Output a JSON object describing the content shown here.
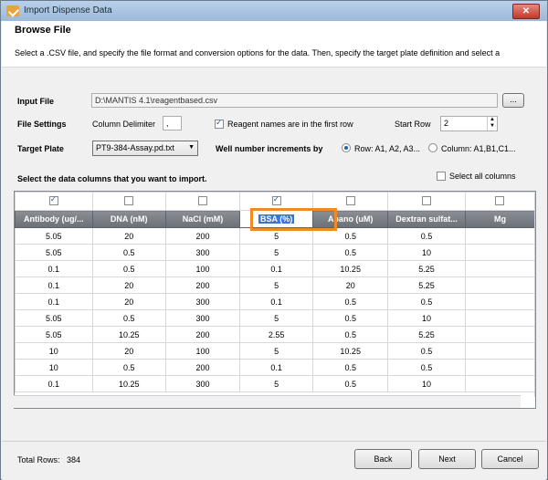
{
  "window": {
    "title": "Import Dispense Data",
    "close_label": "✕"
  },
  "header": {
    "title": "Browse File",
    "description": "Select a .CSV file, and specify the file format and conversion options for the data. Then, specify the target plate definition and select a"
  },
  "form": {
    "input_file_label": "Input File",
    "input_file_value": "D:\\MANTIS 4.1\\reagentbased.csv",
    "browse_label": "...",
    "file_settings_label": "File Settings",
    "column_delimiter_label": "Column Delimiter",
    "column_delimiter_value": ",",
    "reagent_names_label": "Reagent names are in the first row",
    "reagent_names_checked": true,
    "start_row_label": "Start Row",
    "start_row_value": "2",
    "target_plate_label": "Target Plate",
    "target_plate_value": "PT9-384-Assay.pd.txt",
    "well_number_label": "Well number increments by",
    "well_option_row": "Row: A1, A2, A3...",
    "well_option_column": "Column: A1,B1,C1...",
    "well_selected": "row"
  },
  "grid": {
    "section_label": "Select the data columns that you want to import.",
    "select_all_label": "Select all columns",
    "select_all_checked": false,
    "columns": [
      {
        "header": "Antibody (ug/...",
        "checked": true
      },
      {
        "header": "DNA (nM)",
        "checked": false
      },
      {
        "header": "NaCl (mM)",
        "checked": false
      },
      {
        "header": "BSA (%)",
        "checked": true,
        "editing": true
      },
      {
        "header": "Abano (uM)",
        "checked": false
      },
      {
        "header": "Dextran sulfat...",
        "checked": false
      },
      {
        "header": "Mg",
        "checked": false
      }
    ],
    "rows": [
      [
        "5.05",
        "20",
        "200",
        "5",
        "0.5",
        "0.5",
        ""
      ],
      [
        "5.05",
        "0.5",
        "300",
        "5",
        "0.5",
        "10",
        ""
      ],
      [
        "0.1",
        "0.5",
        "100",
        "0.1",
        "10.25",
        "5.25",
        ""
      ],
      [
        "0.1",
        "20",
        "200",
        "5",
        "20",
        "5.25",
        ""
      ],
      [
        "0.1",
        "20",
        "300",
        "0.1",
        "0.5",
        "0.5",
        ""
      ],
      [
        "5.05",
        "0.5",
        "300",
        "5",
        "0.5",
        "10",
        ""
      ],
      [
        "5.05",
        "10.25",
        "200",
        "2.55",
        "0.5",
        "5.25",
        ""
      ],
      [
        "10",
        "20",
        "100",
        "5",
        "10.25",
        "0.5",
        ""
      ],
      [
        "10",
        "0.5",
        "200",
        "0.1",
        "0.5",
        "0.5",
        ""
      ],
      [
        "0.1",
        "10.25",
        "300",
        "5",
        "0.5",
        "10",
        ""
      ]
    ]
  },
  "footer": {
    "total_rows_label": "Total Rows:",
    "total_rows_value": "384",
    "back_label": "Back",
    "next_label": "Next",
    "cancel_label": "Cancel"
  }
}
